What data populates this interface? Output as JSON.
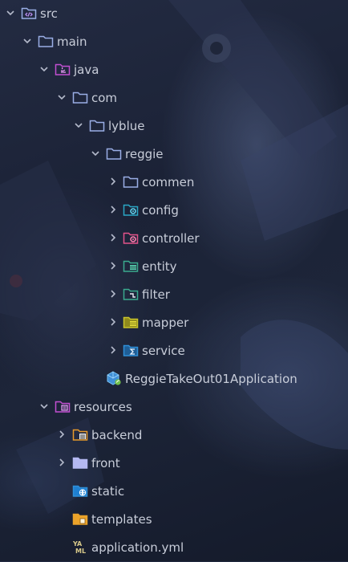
{
  "tree": [
    {
      "id": "src",
      "label": "src",
      "icon": "source-folder-icon",
      "expanded": true
    },
    {
      "id": "main",
      "label": "main",
      "icon": "folder-icon",
      "expanded": true
    },
    {
      "id": "java",
      "label": "java",
      "icon": "java-source-folder-icon",
      "expanded": true
    },
    {
      "id": "com",
      "label": "com",
      "icon": "folder-icon",
      "expanded": true
    },
    {
      "id": "lyblue",
      "label": "lyblue",
      "icon": "folder-icon",
      "expanded": true
    },
    {
      "id": "reggie",
      "label": "reggie",
      "icon": "folder-icon",
      "expanded": true
    },
    {
      "id": "commen",
      "label": "commen",
      "icon": "folder-icon",
      "expanded": false
    },
    {
      "id": "config",
      "label": "config",
      "icon": "config-folder-icon",
      "expanded": false
    },
    {
      "id": "controller",
      "label": "controller",
      "icon": "controller-folder-icon",
      "expanded": false
    },
    {
      "id": "entity",
      "label": "entity",
      "icon": "entity-folder-icon",
      "expanded": false
    },
    {
      "id": "filter",
      "label": "filter",
      "icon": "filter-folder-icon",
      "expanded": false
    },
    {
      "id": "mapper",
      "label": "mapper",
      "icon": "mapper-folder-icon",
      "expanded": false
    },
    {
      "id": "service",
      "label": "service",
      "icon": "service-folder-icon",
      "expanded": false
    },
    {
      "id": "app",
      "label": "ReggieTakeOut01Application",
      "icon": "spring-boot-class-icon"
    },
    {
      "id": "resources",
      "label": "resources",
      "icon": "resources-folder-icon",
      "expanded": true
    },
    {
      "id": "backend",
      "label": "backend",
      "icon": "backend-folder-icon",
      "expanded": false
    },
    {
      "id": "front",
      "label": "front",
      "icon": "folder-icon",
      "expanded": false
    },
    {
      "id": "static",
      "label": "static",
      "icon": "static-web-folder-icon"
    },
    {
      "id": "templates",
      "label": "templates",
      "icon": "templates-folder-icon"
    },
    {
      "id": "yml",
      "label": "application.yml",
      "icon": "yaml-file-icon"
    }
  ],
  "colors": {
    "label": "#c8cdd9",
    "chevron": "#b4bacb",
    "folder_outline": "#9aaee6",
    "java_purple": "#c24fd1",
    "config_teal": "#2aa6c4",
    "controller_pink": "#e2538a",
    "entity_green": "#3aaa8e",
    "mapper_yellow": "#c9c42a",
    "service_blue": "#2f8fd8",
    "backend_orange": "#e89a2a",
    "front_lavender": "#b5b9f2",
    "templates_orange": "#eba32a",
    "yaml_yellow": "#d8c98a"
  }
}
